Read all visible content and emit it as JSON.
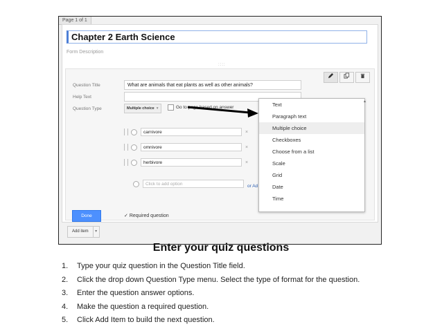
{
  "screenshot": {
    "page_tab": "Page 1 of 1",
    "form_title": "Chapter 2 Earth Science",
    "form_description_placeholder": "Form Description",
    "drag_handle": "::::",
    "question": {
      "title_label": "Question Title",
      "title_value": "What are animals that eat plants as well as other animals?",
      "help_label": "Help Text",
      "help_value": "",
      "type_label": "Question Type",
      "type_value": "Multiple choice",
      "type_chevron": "▾",
      "goto_label": "Go to page based on answer",
      "options": [
        {
          "value": "carnivore"
        },
        {
          "value": "omnivore"
        },
        {
          "value": "herbivore"
        }
      ],
      "add_option_placeholder": "Click to add option",
      "remove_glyph": "×",
      "or_add_text": "or Ad",
      "done_label": "Done",
      "required_label": "Required question",
      "required_check": "✓"
    },
    "tools": {
      "edit_icon": "pencil-icon",
      "duplicate_icon": "duplicate-icon",
      "delete_icon": "trash-icon"
    },
    "type_menu": {
      "items": [
        "Text",
        "Paragraph text",
        "Multiple choice",
        "Checkboxes",
        "Choose from a list",
        "Scale",
        "Grid",
        "Date",
        "Time"
      ],
      "selected": "Multiple choice",
      "scroll_marker": "▴"
    },
    "add_item_label": "Add item",
    "add_item_chevron": "▾"
  },
  "caption": "Enter your quiz questions",
  "steps": [
    {
      "num": "1.",
      "text": "Type your quiz question in the Question Title field."
    },
    {
      "num": "2.",
      "text": "Click the drop down Question Type menu.  Select the type of format for the question."
    },
    {
      "num": "3.",
      "text": "Enter the question answer options."
    },
    {
      "num": "4.",
      "text": "Make the question a required question."
    },
    {
      "num": "5.",
      "text": "Click Add Item to build the next question."
    }
  ],
  "colors": {
    "accent_blue": "#4d90fe",
    "title_border": "#4d7fd6",
    "arrow": "#000000"
  }
}
